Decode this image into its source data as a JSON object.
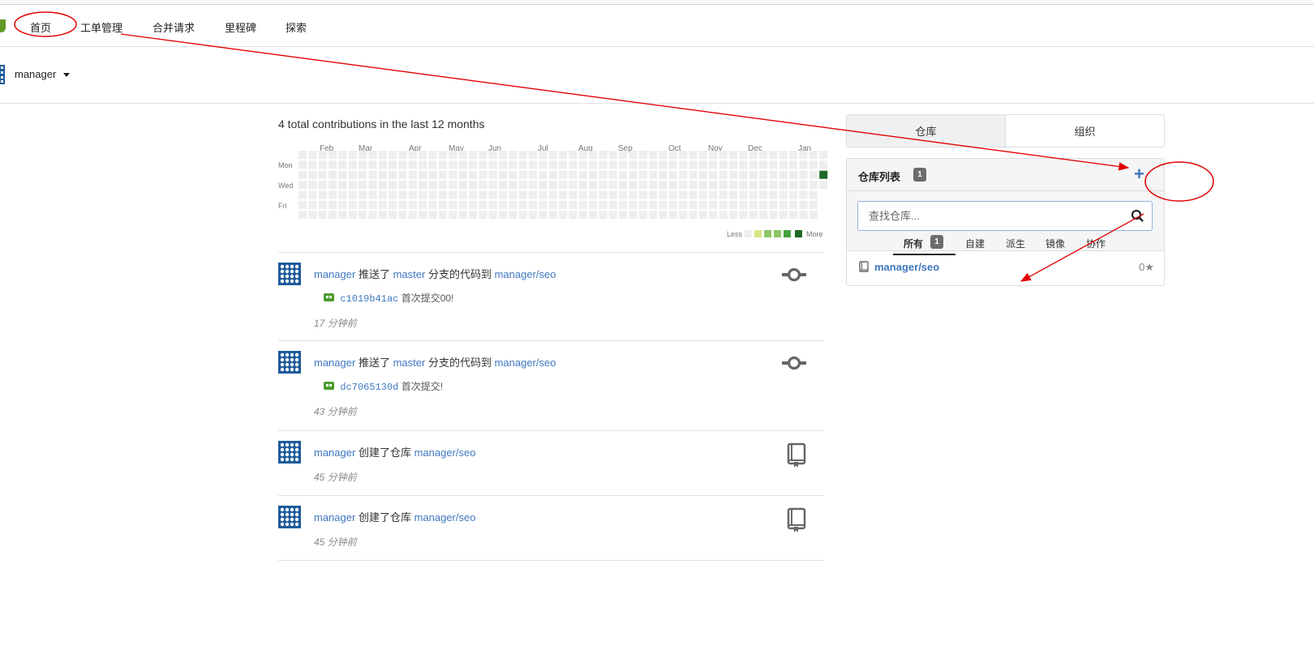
{
  "nav": {
    "items": [
      "首页",
      "工单管理",
      "合并请求",
      "里程碑",
      "探索"
    ]
  },
  "context": {
    "username": "manager"
  },
  "contributions": {
    "summary": "4 total contributions in the last 12 months",
    "months": [
      "Feb",
      "Mar",
      "Apr",
      "May",
      "Jun",
      "Jul",
      "Aug",
      "Sep",
      "Oct",
      "Nov",
      "Dec",
      "Jan"
    ],
    "days": [
      "Mon",
      "Wed",
      "Fri"
    ],
    "legend_less": "Less",
    "legend_more": "More",
    "empty_color": "#eeeeee",
    "active_color": "#1e6823",
    "legend_colors": [
      "#eeeeee",
      "#d6e685",
      "#8cc665",
      "#44a340",
      "#1e6823"
    ]
  },
  "feed": [
    {
      "user": "manager",
      "action": "推送了",
      "branch": "master",
      "action2": "分支的代码到",
      "repo": "manager/seo",
      "sha": "c1019b41ac",
      "message": "首次提交00!",
      "time": "17 分钟前",
      "icon": "git-commit-icon"
    },
    {
      "user": "manager",
      "action": "推送了",
      "branch": "master",
      "action2": "分支的代码到",
      "repo": "manager/seo",
      "sha": "dc7065130d",
      "message": "首次提交!",
      "time": "43 分钟前",
      "icon": "git-commit-icon"
    },
    {
      "user": "manager",
      "action": "创建了仓库",
      "repo": "manager/seo",
      "time": "45 分钟前",
      "icon": "book-icon"
    },
    {
      "user": "manager",
      "action": "创建了仓库",
      "repo": "manager/seo",
      "time": "45 分钟前",
      "icon": "book-icon"
    }
  ],
  "sidebar": {
    "tabs": [
      "仓库",
      "组织"
    ],
    "panel_title": "仓库列表",
    "repo_count": "1",
    "search_placeholder": "查找仓库...",
    "filters": [
      "所有",
      "自建",
      "派生",
      "镜像",
      "协作"
    ],
    "filter_all_count": "1",
    "repos": [
      {
        "name": "manager/seo",
        "stars": "0"
      }
    ]
  },
  "colors": {
    "link": "#4078c0",
    "brand": "#609926",
    "annotation": "#e00000"
  }
}
